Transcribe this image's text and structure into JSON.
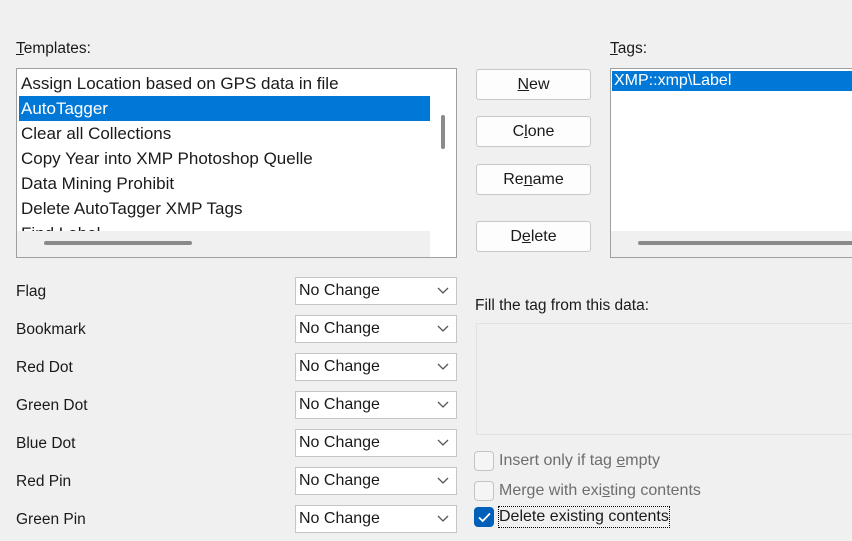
{
  "templates": {
    "label_u": "T",
    "label_rest": "emplates:",
    "items": [
      "Assign Location based on GPS data in file",
      "AutoTagger",
      "Clear all Collections",
      "Copy Year into XMP Photoshop Quelle",
      "Data Mining Prohibit",
      "Delete AutoTagger XMP Tags",
      "Find Label"
    ],
    "selected_index": 1
  },
  "buttons": {
    "new": {
      "u": "N",
      "rest": "ew"
    },
    "clone": {
      "pre": "C",
      "u": "l",
      "rest": "one"
    },
    "rename": {
      "pre": "Re",
      "u": "n",
      "rest": "ame"
    },
    "delete": {
      "pre": "D",
      "u": "e",
      "rest": "lete"
    }
  },
  "tags": {
    "label_u": "T",
    "label_rest": "ags:",
    "items": [
      "XMP::xmp\\Label"
    ]
  },
  "fields": [
    {
      "label": "Flag",
      "value": "No Change"
    },
    {
      "label": "Bookmark",
      "value": "No Change"
    },
    {
      "label": "Red Dot",
      "value": "No Change"
    },
    {
      "label": "Green Dot",
      "value": "No Change"
    },
    {
      "label": "Blue Dot",
      "value": "No Change"
    },
    {
      "label": "Red Pin",
      "value": "No Change"
    },
    {
      "label": "Green Pin",
      "value": "No Change"
    }
  ],
  "fill": {
    "label": "Fill the tag from this data:"
  },
  "options": [
    {
      "pre": "Insert only if tag ",
      "u": "e",
      "rest": "mpty",
      "checked": false,
      "disabled": true
    },
    {
      "pre": "Merge with exi",
      "u": "s",
      "rest": "ting contents",
      "checked": false,
      "disabled": true
    },
    {
      "pre": "Delete existing contents",
      "u": "",
      "rest": "",
      "checked": true,
      "disabled": false
    }
  ],
  "colors": {
    "selection": "#0078d7",
    "checkbox_checked": "#005fb8"
  }
}
